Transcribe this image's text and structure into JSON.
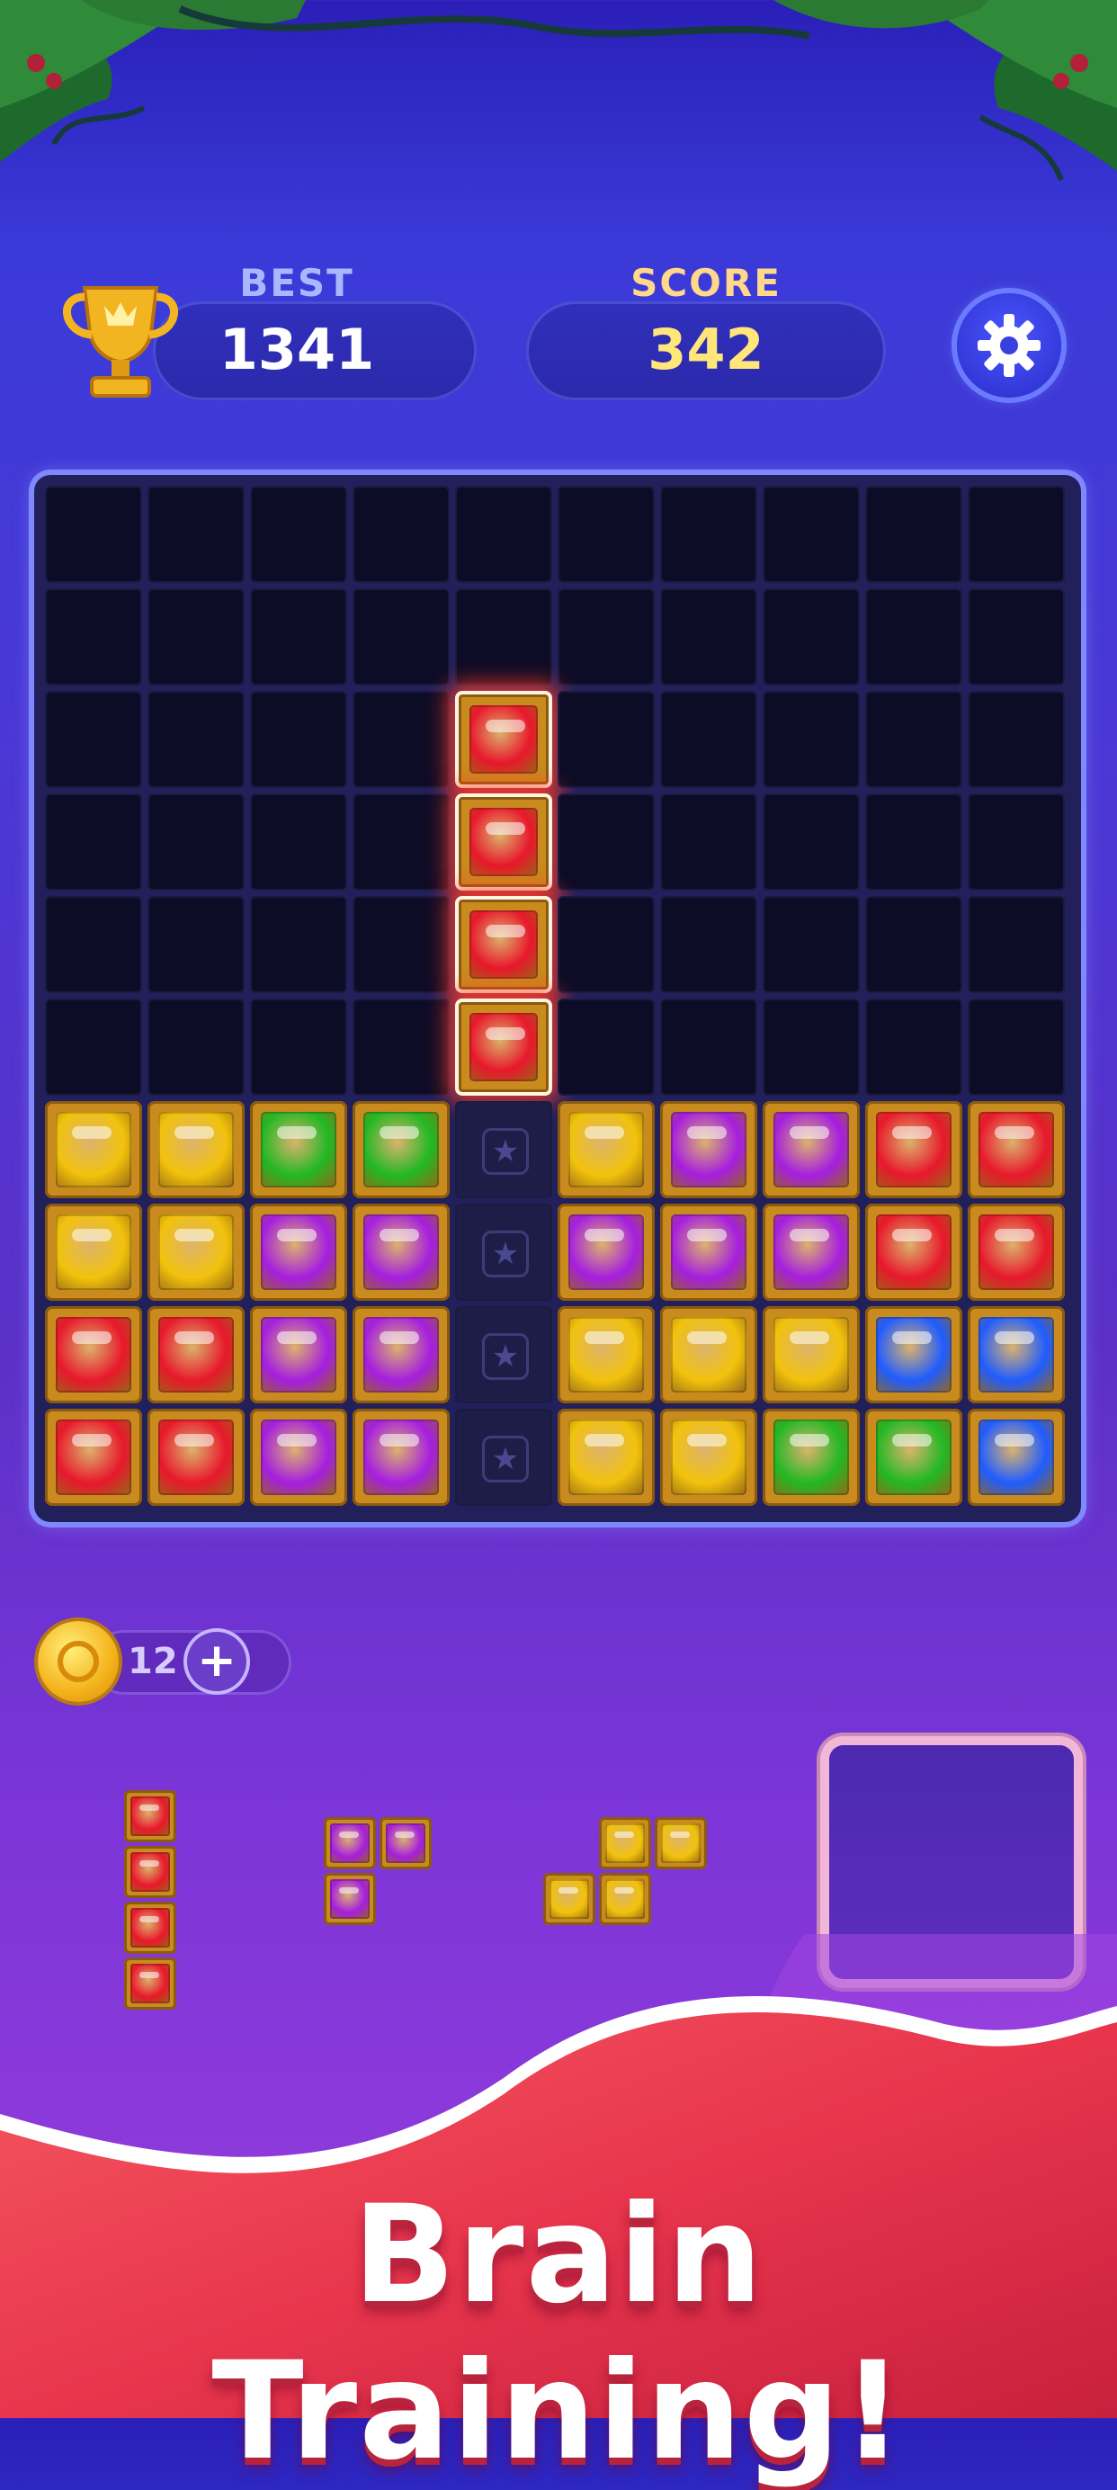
{
  "hud": {
    "best_label": "BEST",
    "best_value": "1341",
    "score_label": "SCORE",
    "score_value": "342",
    "settings_icon": "gear-icon",
    "trophy_icon": "trophy-icon"
  },
  "board": {
    "rows": 10,
    "cols": 10,
    "placed_blocks": [
      [
        "yellow",
        "yellow",
        "green",
        "green",
        null,
        "yellow",
        "purple",
        "purple",
        "red",
        "red"
      ],
      [
        "yellow",
        "yellow",
        "purple",
        "purple",
        null,
        "purple",
        "purple",
        "purple",
        "red",
        "red"
      ],
      [
        "red",
        "red",
        "purple",
        "purple",
        null,
        "yellow",
        "yellow",
        "yellow",
        "blue",
        "blue"
      ],
      [
        "red",
        "red",
        "purple",
        "purple",
        null,
        "yellow",
        "yellow",
        "green",
        "green",
        "blue"
      ]
    ],
    "placed_start_row": 6,
    "star_column": 4,
    "falling_piece": {
      "color": "red",
      "column": 4,
      "rows": [
        2,
        3,
        4,
        5
      ]
    }
  },
  "coins": {
    "count": "12",
    "icon": "coin-icon",
    "add_icon": "plus-icon"
  },
  "pieces": [
    {
      "name": "piece-vertical-4",
      "color": "red",
      "cells": [
        [
          0,
          0
        ],
        [
          0,
          1
        ],
        [
          0,
          2
        ],
        [
          0,
          3
        ]
      ]
    },
    {
      "name": "piece-l-3",
      "color": "purple",
      "cells": [
        [
          0,
          0
        ],
        [
          1,
          0
        ],
        [
          0,
          1
        ]
      ]
    },
    {
      "name": "piece-s-4",
      "color": "yellow",
      "cells": [
        [
          1,
          0
        ],
        [
          2,
          0
        ],
        [
          0,
          1
        ],
        [
          1,
          1
        ]
      ]
    }
  ],
  "banner": {
    "text": "Brain Training!"
  },
  "colors": {
    "red": "#e8182c",
    "yellow": "#f2c20c",
    "green": "#22b824",
    "purple": "#a51ee0",
    "blue": "#1f5cff",
    "frame": "#c98a1e"
  }
}
